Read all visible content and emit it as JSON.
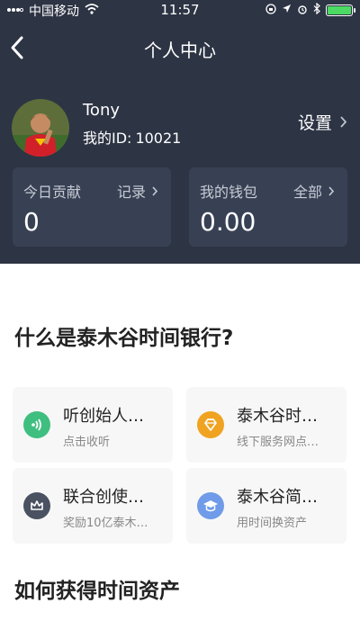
{
  "status_bar": {
    "carrier": "中国移动",
    "time": "11:57"
  },
  "nav": {
    "title": "个人中心"
  },
  "profile": {
    "name": "Tony",
    "id_label": "我的ID:",
    "id_value": "10021",
    "settings_label": "设置"
  },
  "cards": [
    {
      "label": "今日贡献",
      "link": "记录",
      "value": "0"
    },
    {
      "label": "我的钱包",
      "link": "全部",
      "value": "0.00"
    }
  ],
  "section1": {
    "title": "什么是泰木谷时间银行?"
  },
  "tiles": [
    {
      "title": "听创始人…",
      "subtitle": "点击收听",
      "icon": "audio-icon",
      "color": "#3fbf7f"
    },
    {
      "title": "泰木谷时…",
      "subtitle": "线下服务网点…",
      "icon": "diamond-icon",
      "color": "#f0a320"
    },
    {
      "title": "联合创使…",
      "subtitle": "奖励10亿泰木…",
      "icon": "crown-icon",
      "color": "#4a5161"
    },
    {
      "title": "泰木谷简…",
      "subtitle": "用时间换资产",
      "icon": "graduation-cap-icon",
      "color": "#6f9be8"
    }
  ],
  "section2": {
    "title": "如何获得时间资产"
  }
}
